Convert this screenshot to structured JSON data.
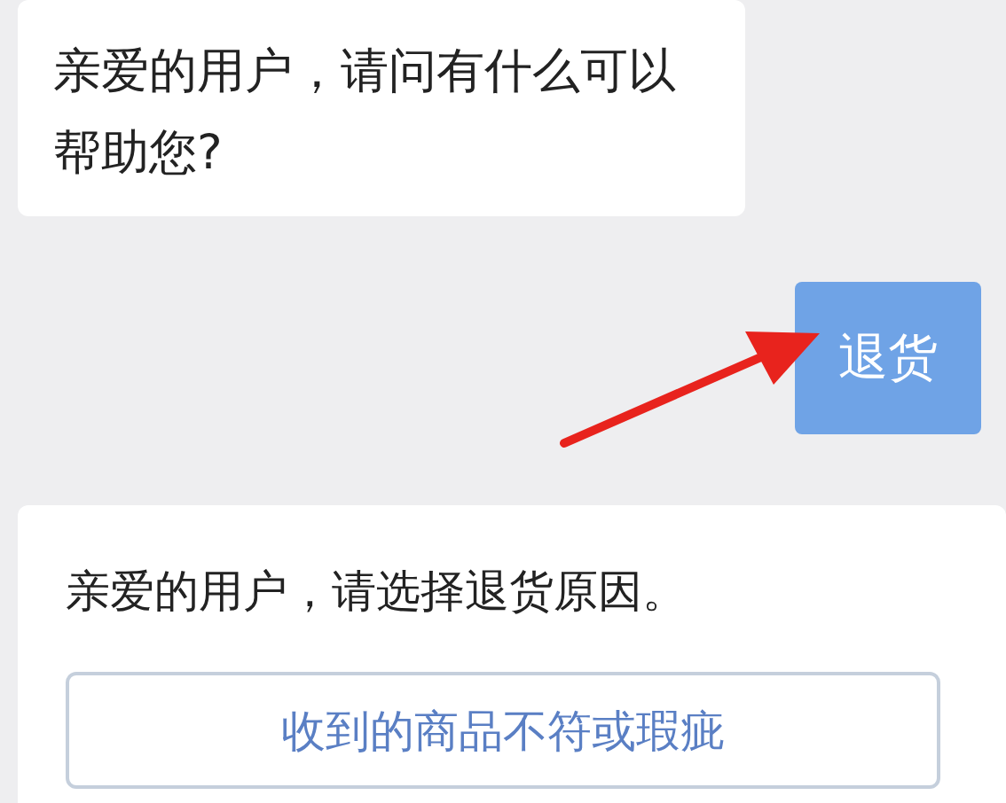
{
  "messages": [
    {
      "kind": "bot",
      "text": "亲爱的用户，请问有什么可以帮助您?"
    },
    {
      "kind": "user",
      "text": "退货"
    },
    {
      "kind": "bot",
      "text": "亲爱的用户，请选择退货原因。",
      "options": [
        "收到的商品不符或瑕疵"
      ]
    }
  ]
}
